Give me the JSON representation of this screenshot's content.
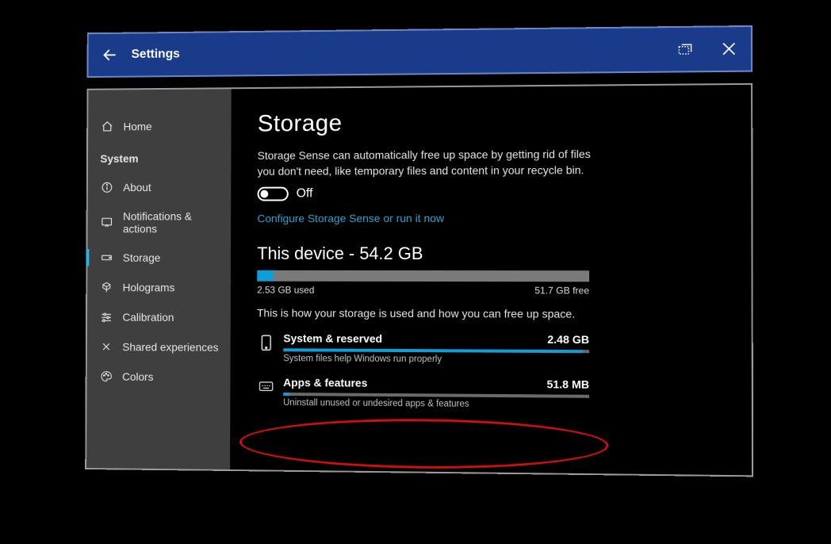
{
  "titlebar": {
    "title": "Settings"
  },
  "sidebar": {
    "home": "Home",
    "group": "System",
    "items": [
      {
        "label": "About"
      },
      {
        "label": "Notifications & actions"
      },
      {
        "label": "Storage"
      },
      {
        "label": "Holograms"
      },
      {
        "label": "Calibration"
      },
      {
        "label": "Shared experiences"
      },
      {
        "label": "Colors"
      }
    ]
  },
  "storage": {
    "title": "Storage",
    "sense_desc": "Storage Sense can automatically free up space by getting rid of files you don't need, like temporary files and content in your recycle bin.",
    "toggle_label": "Off",
    "configure_link": "Configure Storage Sense or run it now",
    "device_heading": "This device - 54.2 GB",
    "used_label": "2.53 GB used",
    "free_label": "51.7 GB free",
    "used_pct": 5,
    "breakdown_desc": "This is how your storage is used and how you can free up space.",
    "rows": [
      {
        "name": "System & reserved",
        "size": "2.48 GB",
        "pct": 98,
        "sub": "System files help Windows run properly"
      },
      {
        "name": "Apps & features",
        "size": "51.8 MB",
        "pct": 2,
        "sub": "Uninstall unused or undesired apps & features"
      }
    ]
  }
}
